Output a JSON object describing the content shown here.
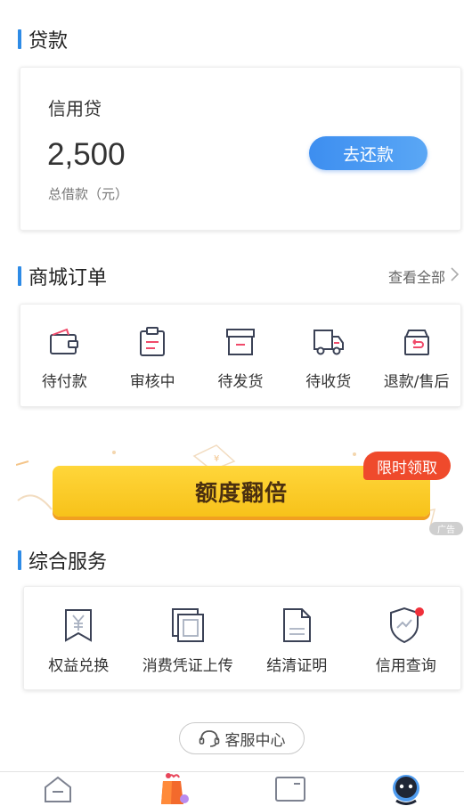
{
  "loan_section": {
    "title": "贷款"
  },
  "loan_card": {
    "name": "信用贷",
    "amount": "2,500",
    "caption": "总借款（元）",
    "repay_button": "去还款"
  },
  "orders_section": {
    "title": "商城订单",
    "view_all": "查看全部",
    "items": [
      {
        "label": "待付款",
        "icon": "wallet-icon"
      },
      {
        "label": "审核中",
        "icon": "clipboard-icon"
      },
      {
        "label": "待发货",
        "icon": "box-icon"
      },
      {
        "label": "待收货",
        "icon": "truck-icon"
      },
      {
        "label": "退款/售后",
        "icon": "return-box-icon"
      }
    ]
  },
  "banner": {
    "button_text": "额度翻倍",
    "tag": "限时领取",
    "ad_label": "广告"
  },
  "services_section": {
    "title": "综合服务",
    "items": [
      {
        "label": "权益兑换",
        "icon": "yen-bookmark-icon"
      },
      {
        "label": "消费凭证上传",
        "icon": "stacked-pages-icon"
      },
      {
        "label": "结清证明",
        "icon": "document-icon"
      },
      {
        "label": "信用查询",
        "icon": "shield-chart-icon"
      }
    ]
  },
  "customer_service": {
    "label": "客服中心"
  },
  "bottom_nav": {
    "items": [
      {
        "icon": "home-icon"
      },
      {
        "icon": "shopping-bag-icon"
      },
      {
        "icon": "card-icon"
      },
      {
        "icon": "profile-icon"
      }
    ]
  },
  "colors": {
    "accent": "#2e8be6",
    "repay_button": "#4a9af2",
    "icon_stroke": "#3b4256",
    "icon_accent": "#f04a6a",
    "banner_yellow": "#fbcc2a",
    "tag_red": "#ef4a2c"
  }
}
